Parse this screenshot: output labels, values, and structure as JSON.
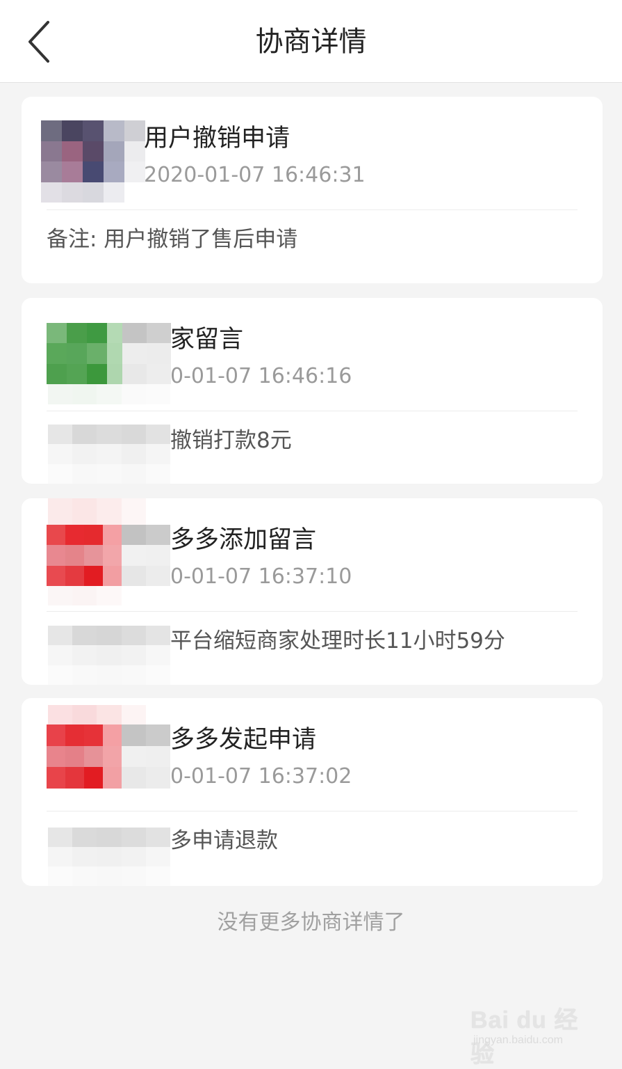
{
  "header": {
    "title": "协商详情",
    "back_icon": "chevron-left-icon"
  },
  "records": [
    {
      "title": "用户撤销申请",
      "time": "2020-01-07 16:46:31",
      "note": "备注: 用户撤销了售后申请"
    },
    {
      "title": "家留言",
      "time": "0-01-07 16:46:16",
      "note": "撤销打款8元"
    },
    {
      "title": "多多添加留言",
      "time": "0-01-07 16:37:10",
      "note": "平台缩短商家处理时长11小时59分"
    },
    {
      "title": "多多发起申请",
      "time": "0-01-07 16:37:02",
      "note": "多申请退款"
    }
  ],
  "footer": {
    "end_text": "没有更多协商详情了"
  },
  "watermark": {
    "logo": "Bai du 经验",
    "sub": "jingyan.baidu.com"
  }
}
